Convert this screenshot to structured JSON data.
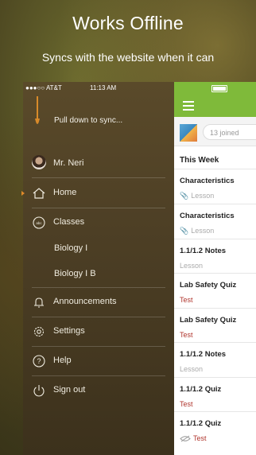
{
  "promo": {
    "title": "Works Offline",
    "subtitle": "Syncs with the website when it can"
  },
  "status_bar": {
    "carrier": "●●●○○ AT&T",
    "time": "11:13 AM"
  },
  "pull": {
    "label": "Pull down to sync..."
  },
  "profile": {
    "name": "Mr. Neri"
  },
  "menu": {
    "home": "Home",
    "classes": "Classes",
    "classes_items": [
      "Biology I",
      "Biology I B"
    ],
    "announcements": "Announcements",
    "settings": "Settings",
    "help": "Help",
    "sign_out": "Sign out"
  },
  "content": {
    "group_join": "13 joined",
    "section_title": "This Week",
    "posts": [
      {
        "title": "Characteristics",
        "type": "Lesson",
        "clip": "📎"
      },
      {
        "title": "Characteristics",
        "type": "Lesson",
        "clip": "📎"
      },
      {
        "title": "1.1/1.2 Notes",
        "type": "Lesson"
      },
      {
        "title": "Lab Safety Quiz",
        "type": "Test"
      },
      {
        "title": "Lab Safety Quiz",
        "type": "Test"
      },
      {
        "title": "1.1/1.2 Notes",
        "type": "Lesson"
      },
      {
        "title": "1.1/1.2 Quiz",
        "type": "Test"
      },
      {
        "title": "1.1/1.2 Quiz",
        "type": "Test"
      }
    ]
  },
  "colors": {
    "accent_green": "#7fba3a",
    "test_red": "#b0362e",
    "active_orange": "#e08a2a"
  }
}
